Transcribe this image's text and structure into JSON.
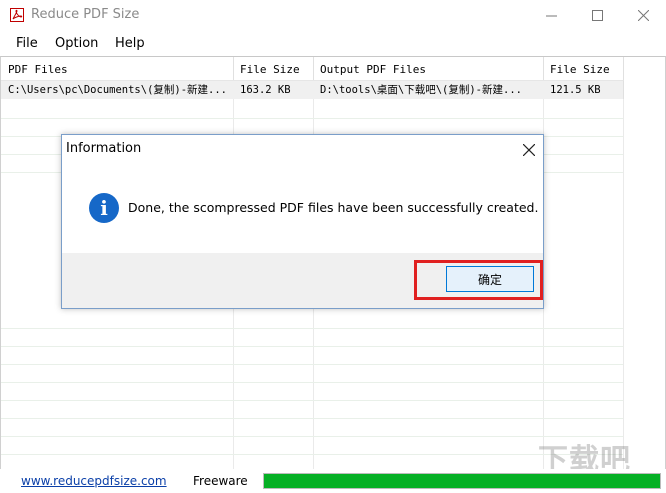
{
  "window": {
    "title": "Reduce PDF Size"
  },
  "menu": [
    "File",
    "Option",
    "Help"
  ],
  "table": {
    "columns": [
      "PDF Files",
      "File Size",
      "Output PDF Files",
      "File Size"
    ],
    "rows": [
      [
        "C:\\Users\\pc\\Documents\\(复制)-新建...",
        "163.2 KB",
        "D:\\tools\\桌面\\下载吧\\(复制)-新建...",
        "121.5 KB"
      ]
    ]
  },
  "dialog": {
    "title": "Information",
    "message": "Done, the scompressed PDF files have been successfully created.",
    "ok_label": "确定"
  },
  "status": {
    "link": "www.reducepdfsize.com",
    "license": "Freeware",
    "progress": 1.0
  },
  "watermark": "下载吧",
  "colors": {
    "progress": "#06b025",
    "highlight": "#e02020",
    "info_icon": "#1668c8"
  }
}
